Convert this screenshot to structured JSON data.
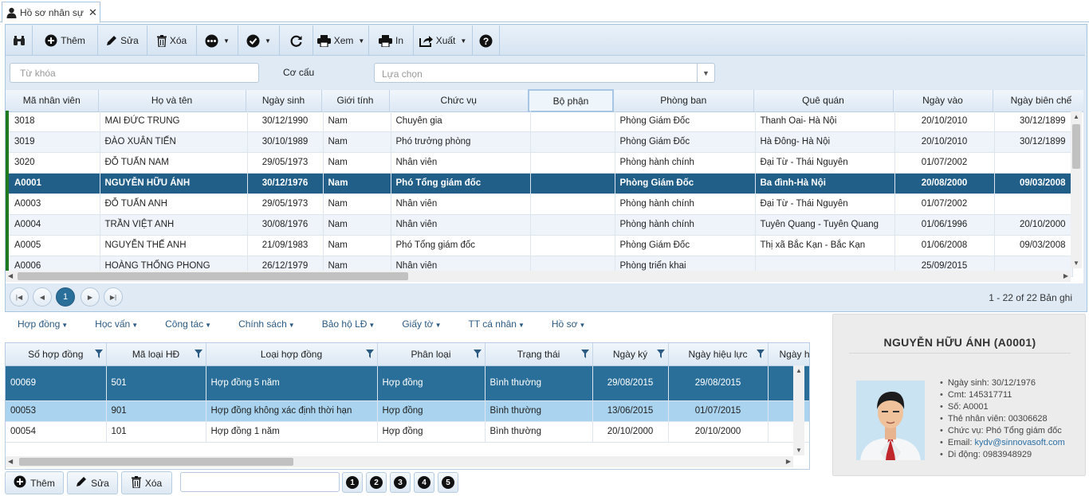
{
  "tab": {
    "title": "Hồ sơ nhân sự",
    "close_icon": "close-icon",
    "icon": "user-icon"
  },
  "toolbar": {
    "search_icon": "binoculars-icon",
    "add_label": "Thêm",
    "edit_label": "Sửa",
    "delete_label": "Xóa",
    "more_icon": "more-dots-icon",
    "check_icon": "check-circle-icon",
    "refresh_icon": "refresh-icon",
    "view_label": "Xem",
    "print_label": "In",
    "export_label": "Xuất",
    "help_icon": "help-icon"
  },
  "search": {
    "keyword_placeholder": "Từ khóa",
    "structure_label": "Cơ cấu",
    "select_placeholder": "Lựa chọn"
  },
  "grid1": {
    "columns": [
      "Mã nhân viên",
      "Họ và tên",
      "Ngày sinh",
      "Giới tính",
      "Chức vụ",
      "Bộ phận",
      "Phòng ban",
      "Quê quán",
      "Ngày vào",
      "Ngày biên chế"
    ],
    "rows": [
      [
        "3018",
        "MAI ĐỨC TRUNG",
        "30/12/1990",
        "Nam",
        "Chuyên gia",
        "",
        "Phòng Giám Đốc",
        "Thanh Oai- Hà Nội",
        "20/10/2010",
        "30/12/1899"
      ],
      [
        "3019",
        "ĐÀO XUÂN TIẾN",
        "30/10/1989",
        "Nam",
        "Phó trưởng phòng",
        "",
        "Phòng Giám Đốc",
        "Hà Đông- Hà Nội",
        "20/10/2010",
        "30/12/1899"
      ],
      [
        "3020",
        "ĐỖ TUẤN NAM",
        "29/05/1973",
        "Nam",
        "Nhân viên",
        "",
        "Phòng hành chính",
        "Đại Từ - Thái Nguyên",
        "01/07/2002",
        ""
      ],
      [
        "A0001",
        "NGUYỄN HỮU ÁNH",
        "30/12/1976",
        "Nam",
        "Phó Tổng giám đốc",
        "",
        "Phòng Giám Đốc",
        "Ba đình-Hà Nội",
        "20/08/2000",
        "09/03/2008"
      ],
      [
        "A0003",
        "ĐỖ TUẤN ANH",
        "29/05/1973",
        "Nam",
        "Nhân viên",
        "",
        "Phòng hành chính",
        "Đại Từ - Thái Nguyên",
        "01/07/2002",
        ""
      ],
      [
        "A0004",
        "TRẦN VIỆT ANH",
        "30/08/1976",
        "Nam",
        "Nhân viên",
        "",
        "Phòng hành chính",
        "Tuyên Quang - Tuyên Quang",
        "01/06/1996",
        "20/10/2000"
      ],
      [
        "A0005",
        "NGUYỄN THẾ ANH",
        "21/09/1983",
        "Nam",
        "Phó Tổng giám đốc",
        "",
        "Phòng Giám Đốc",
        "Thị xã Bắc Kạn - Bắc Kạn",
        "01/06/2008",
        "09/03/2008"
      ],
      [
        "A0006",
        "HOÀNG THỐNG PHONG",
        "26/12/1979",
        "Nam",
        "Nhân viên",
        "",
        "Phòng triển khai",
        "",
        "25/09/2015",
        ""
      ]
    ],
    "active_row": 3
  },
  "pager": {
    "current_page": "1",
    "info": "1 - 22 of 22 Bản ghi"
  },
  "subtabs": [
    "Hợp đồng",
    "Học vấn",
    "Công tác",
    "Chính sách",
    "Bảo hộ LĐ",
    "Giấy tờ",
    "TT cá nhân",
    "Hồ sơ"
  ],
  "grid2": {
    "columns": [
      "Số hợp đồng",
      "Mã loại HĐ",
      "Loại hợp đồng",
      "Phân loại",
      "Trạng thái",
      "Ngày ký",
      "Ngày hiệu lực",
      "Ngày hết hạn"
    ],
    "rows": [
      [
        "00069",
        "501",
        "Hợp đồng 5 năm",
        "Hợp đồng",
        "Bình thường",
        "29/08/2015",
        "29/08/2015",
        ""
      ],
      [
        "00053",
        "901",
        "Hợp đồng không xác định thời hạn",
        "Hợp đồng",
        "Bình thường",
        "13/06/2015",
        "01/07/2015",
        ""
      ],
      [
        "00054",
        "101",
        "Hợp đồng 1 năm",
        "Hợp đồng",
        "Bình thường",
        "20/10/2000",
        "20/10/2000",
        ""
      ]
    ]
  },
  "bottom": {
    "add_label": "Thêm",
    "edit_label": "Sửa",
    "delete_label": "Xóa",
    "input_value": "",
    "numbers": [
      "1",
      "2",
      "3",
      "4",
      "5"
    ]
  },
  "profile": {
    "name": "NGUYỄN HỮU ÁNH (A0001)",
    "info": [
      "Ngày sinh: 30/12/1976",
      "Cmt: 145317711",
      "Số: A0001",
      "Thẻ nhân viên: 00306628",
      "Chức vụ: Phó Tổng giám đốc"
    ],
    "email_label": "Email: ",
    "email": "kydv@sinnovasoft.com",
    "phone": "Di động: 0983948929"
  },
  "colors": {
    "accent": "#2a6f9a",
    "active_row": "#215f89",
    "row_marker": "#1f7a1f",
    "link": "#2b5a83"
  }
}
